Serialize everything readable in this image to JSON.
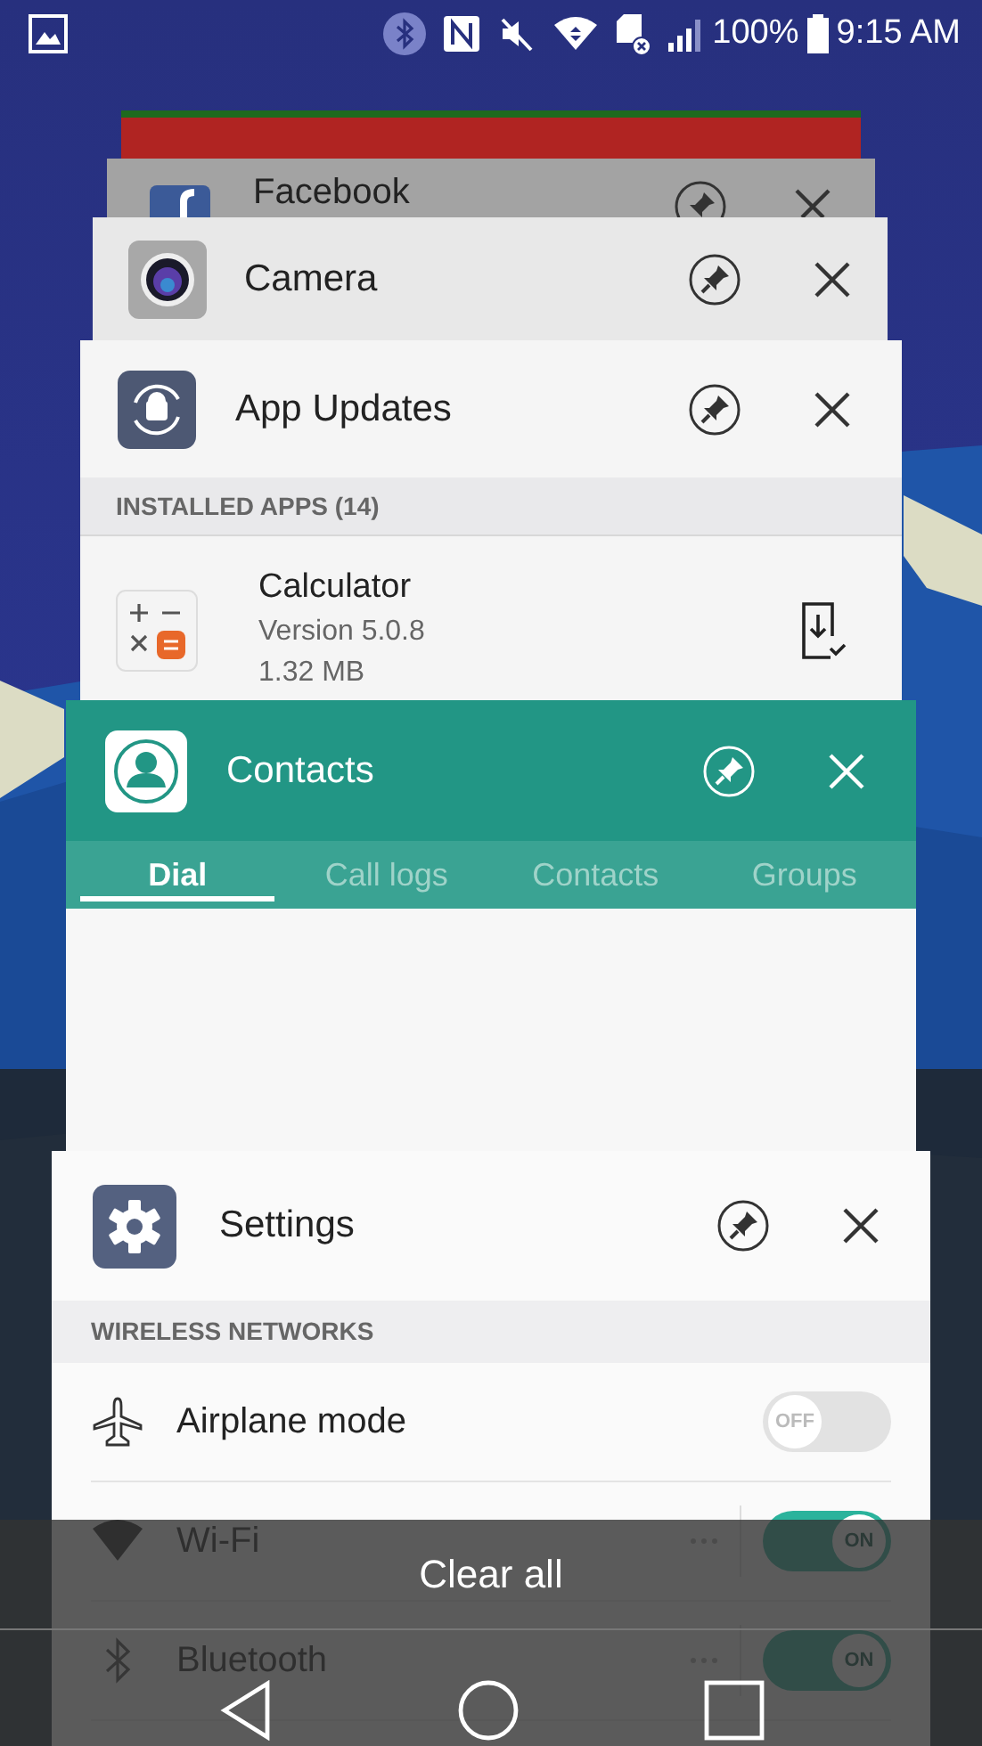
{
  "status_bar": {
    "battery": "100%",
    "time": "9:15 AM"
  },
  "facebook_card": {
    "title": "Facebook"
  },
  "camera_card": {
    "title": "Camera"
  },
  "app_updates_card": {
    "title": "App Updates",
    "section": "INSTALLED APPS (14)",
    "app": {
      "name": "Calculator",
      "version": "Version 5.0.8",
      "size": "1.32 MB"
    }
  },
  "contacts_card": {
    "title": "Contacts",
    "tabs": [
      {
        "label": "Dial",
        "selected": true
      },
      {
        "label": "Call logs",
        "selected": false
      },
      {
        "label": "Contacts",
        "selected": false
      },
      {
        "label": "Groups",
        "selected": false
      }
    ]
  },
  "settings_card": {
    "title": "Settings",
    "section": "WIRELESS NETWORKS",
    "rows": [
      {
        "kind": "airplane",
        "label": "Airplane mode",
        "on": false,
        "switch_label": "OFF"
      },
      {
        "kind": "wifi",
        "label": "Wi-Fi",
        "on": true,
        "switch_label": "ON"
      },
      {
        "kind": "bluetooth",
        "label": "Bluetooth",
        "on": true,
        "switch_label": "ON"
      }
    ]
  },
  "clear_all": "Clear all"
}
